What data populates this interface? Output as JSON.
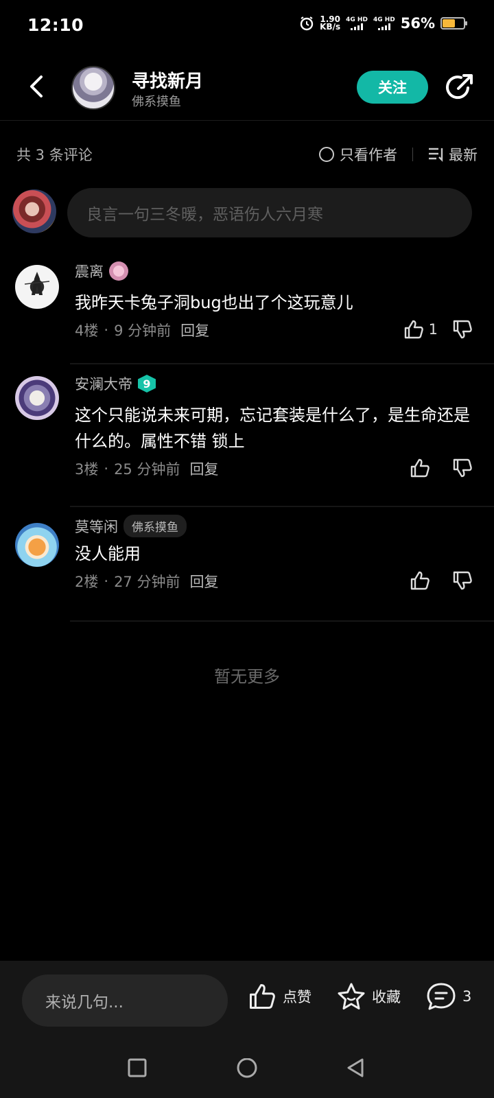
{
  "status_bar": {
    "time": "12:10",
    "net_speed_value": "1.90",
    "net_speed_unit": "KB/s",
    "sim1_label": "4G HD",
    "sim2_label": "4G HD",
    "battery_percent": "56%",
    "battery_level": 0.56,
    "battery_color": "#f7b83a"
  },
  "header": {
    "author_name": "寻找新月",
    "author_subtitle": "佛系摸鱼",
    "follow_label": "关注",
    "accent_color": "#13b8a6"
  },
  "comments_meta": {
    "count_label": "共 3 条评论",
    "author_only_label": "只看作者",
    "sort_label": "最新"
  },
  "comment_input": {
    "placeholder": "良言一句三冬暖，恶语伤人六月寒"
  },
  "comments": [
    {
      "username": "震离",
      "text": "我昨天卡兔子洞bug也出了个这玩意儿",
      "floor": "4楼",
      "time": "9 分钟前",
      "reply_label": "回复",
      "likes": "1"
    },
    {
      "username": "安澜大帝",
      "level": "9",
      "text": "这个只能说未来可期，忘记套装是什么了，是生命还是什么的。属性不错 锁上",
      "floor": "3楼",
      "time": "25 分钟前",
      "reply_label": "回复"
    },
    {
      "username": "莫等闲",
      "tag": "佛系摸鱼",
      "text": "没人能用",
      "floor": "2楼",
      "time": "27 分钟前",
      "reply_label": "回复"
    }
  ],
  "separator": "·",
  "no_more_label": "暂无更多",
  "bottom_bar": {
    "say_placeholder": "来说几句...",
    "like_label": "点赞",
    "favorite_label": "收藏",
    "comment_count": "3"
  }
}
